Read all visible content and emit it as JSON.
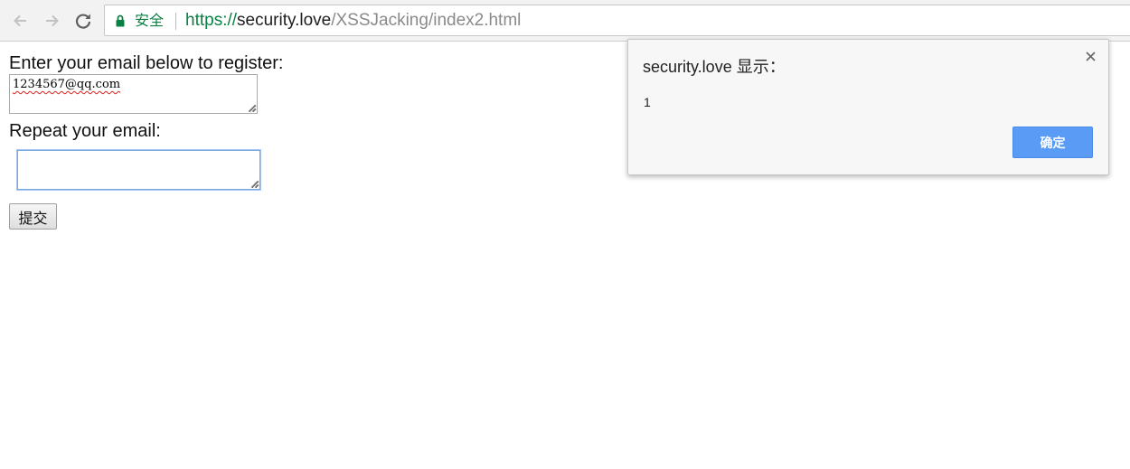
{
  "browser": {
    "secure_label": "安全",
    "url": {
      "scheme": "https://",
      "host": "security.love",
      "path": "/XSSJacking/index2.html"
    },
    "colors": {
      "secure": "#0b8043",
      "toolbar": "#f2f2f2"
    },
    "icons": [
      "back-arrow-icon",
      "forward-arrow-icon",
      "reload-icon",
      "lock-icon"
    ]
  },
  "form": {
    "email_label": "Enter your email below to register:",
    "email_value": "1234567@qq.com",
    "repeat_label": "Repeat your email:",
    "repeat_value": "",
    "submit_label": "提交"
  },
  "alert": {
    "title": "security.love 显示：",
    "message": "1",
    "ok_label": "确定",
    "colors": {
      "ok_button": "#5a9bf6"
    }
  }
}
